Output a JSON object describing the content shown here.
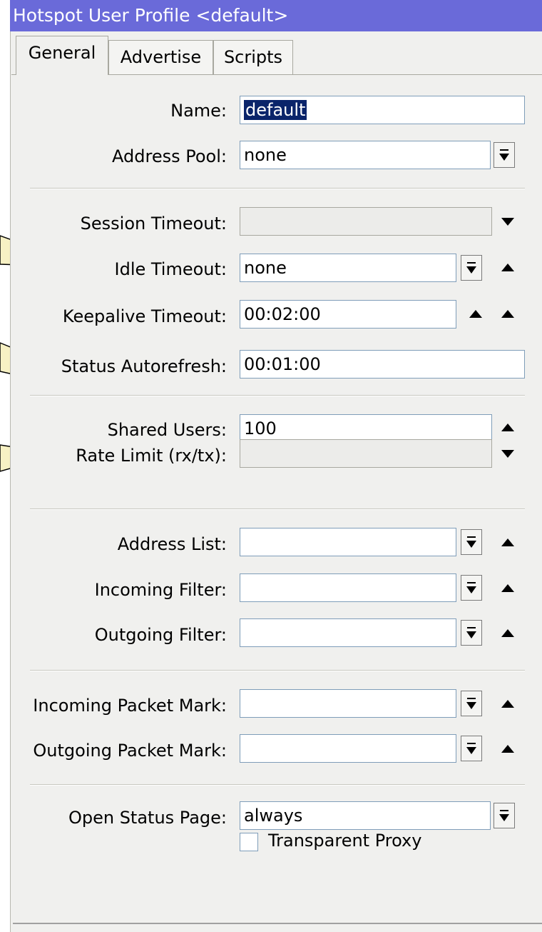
{
  "window": {
    "title": "Hotspot User Profile <default>"
  },
  "tabs": [
    {
      "label": "General",
      "active": true
    },
    {
      "label": "Advertise",
      "active": false
    },
    {
      "label": "Scripts",
      "active": false
    }
  ],
  "form": {
    "name": {
      "label": "Name:",
      "value": "default"
    },
    "address_pool": {
      "label": "Address Pool:",
      "value": "none"
    },
    "session_timeout": {
      "label": "Session Timeout:",
      "value": ""
    },
    "idle_timeout": {
      "label": "Idle Timeout:",
      "value": "none"
    },
    "keepalive_timeout": {
      "label": "Keepalive Timeout:",
      "value": "00:02:00"
    },
    "status_autorefresh": {
      "label": "Status Autorefresh:",
      "value": "00:01:00"
    },
    "shared_users": {
      "label": "Shared Users:",
      "value": "100"
    },
    "rate_limit": {
      "label": "Rate Limit (rx/tx):",
      "value": ""
    },
    "address_list": {
      "label": "Address List:",
      "value": ""
    },
    "incoming_filter": {
      "label": "Incoming Filter:",
      "value": ""
    },
    "outgoing_filter": {
      "label": "Outgoing Filter:",
      "value": ""
    },
    "incoming_packet_mark": {
      "label": "Incoming Packet Mark:",
      "value": ""
    },
    "outgoing_packet_mark": {
      "label": "Outgoing Packet Mark:",
      "value": ""
    },
    "open_status_page": {
      "label": "Open Status Page:",
      "value": "always"
    },
    "transparent_proxy": {
      "label": "Transparent Proxy",
      "checked": false
    }
  },
  "colors": {
    "titlebar": "#6a6ad9",
    "panel": "#f0f0ee",
    "selection": "#0a246a",
    "callout_fill": "#f7f1c4"
  }
}
